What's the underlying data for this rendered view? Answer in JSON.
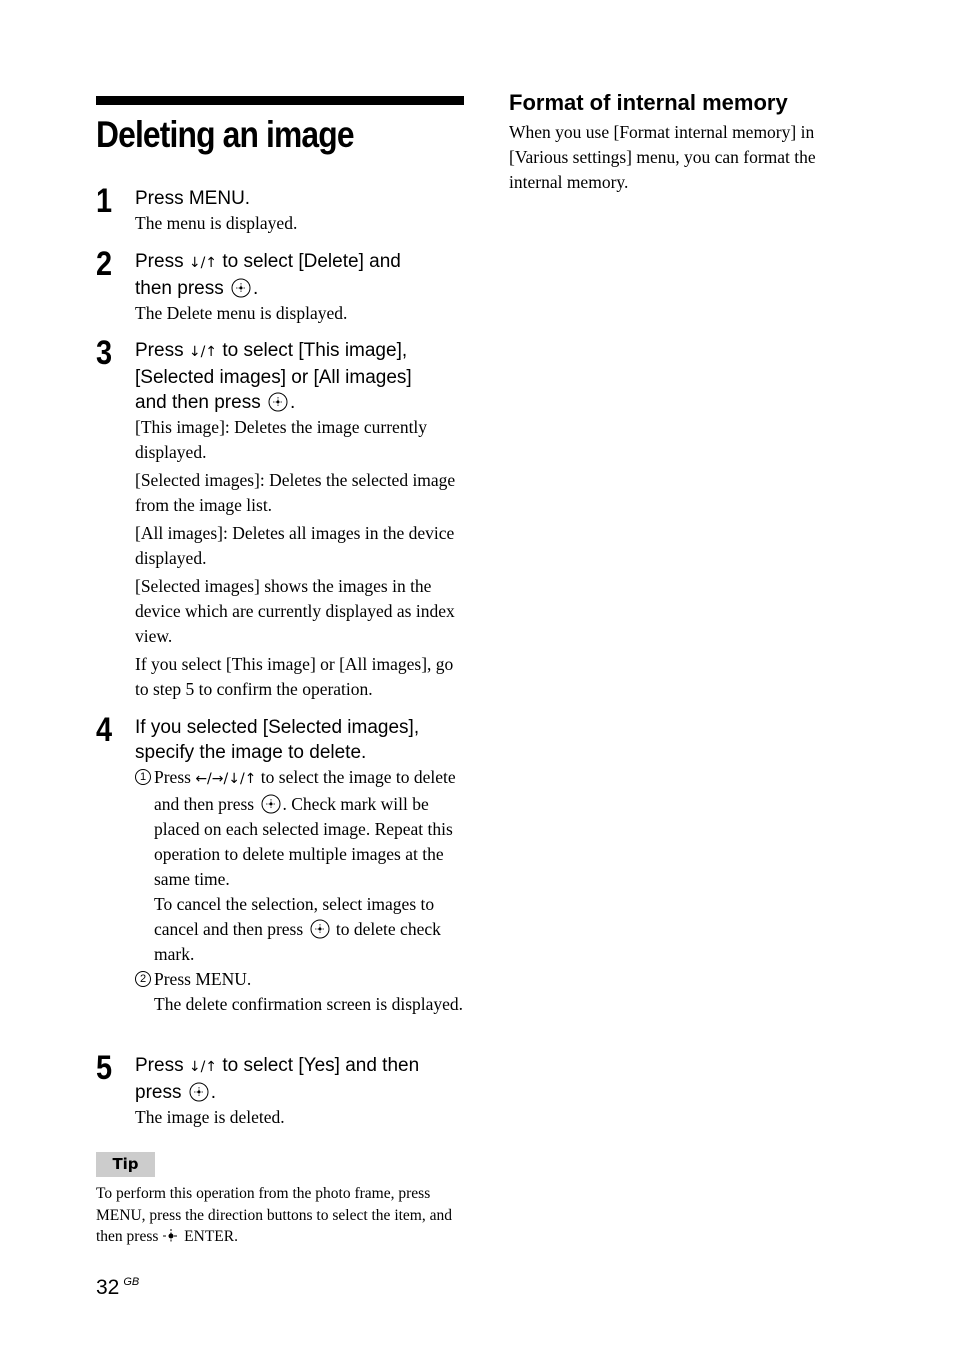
{
  "page": {
    "title": "Deleting an image",
    "page_number": "32",
    "page_suffix": "GB"
  },
  "steps": [
    {
      "number": "1",
      "instruction": [
        "Press MENU."
      ],
      "descriptions": [
        "The menu is displayed."
      ]
    },
    {
      "number": "2",
      "instruction_parts": {
        "pre": "Press ",
        "arrows": "↓/↑",
        "mid": " to select [Delete] and",
        "line2": "then press",
        "end": "."
      },
      "descriptions": [
        "The Delete menu is displayed."
      ]
    },
    {
      "number": "3",
      "instruction_parts": {
        "pre": "Press ",
        "arrows": "↓/↑",
        "mid": " to select [This image],",
        "line2": "[Selected images] or [All images]",
        "line3": "and then press",
        "end": "."
      },
      "descriptions": [
        "[This image]: Deletes the image currently displayed.",
        "[Selected images]: Deletes the selected image from the image list.",
        "[All images]: Deletes all images in the device displayed.",
        "[Selected images] shows the images in the device which are currently displayed as index view.",
        "If you select [This image] or [All images], go to step 5 to confirm the operation."
      ]
    },
    {
      "number": "4",
      "instruction": [
        "If you selected [Selected images],",
        "specify the image to delete."
      ],
      "substeps": [
        {
          "marker": "1",
          "pre": "Press ",
          "arrows": "←/→/↓/↑",
          "text1": " to select the image to delete and then press",
          "text2": ". Check mark will be placed on each selected image. Repeat this operation to delete multiple images at the same time.",
          "text3": "To cancel the selection, select images to cancel and then press",
          "text4": " to delete check mark."
        },
        {
          "marker": "2",
          "text1": "Press MENU.",
          "text2": "The delete confirmation screen is displayed."
        }
      ]
    },
    {
      "number": "5",
      "instruction_parts": {
        "pre": "Press ",
        "arrows": "↓/↑",
        "mid": " to select [Yes] and then",
        "line2": "press",
        "end": "."
      },
      "descriptions": [
        "The image is deleted."
      ]
    }
  ],
  "tip": {
    "label": "Tip",
    "text_pre": "To perform this operation from the photo frame, press MENU, press the direction buttons to select the item, and then press ",
    "text_post": " ENTER."
  },
  "right_section": {
    "heading": "Format of internal memory",
    "text": "When you use [Format internal memory] in [Various settings] menu, you can format the internal memory."
  }
}
